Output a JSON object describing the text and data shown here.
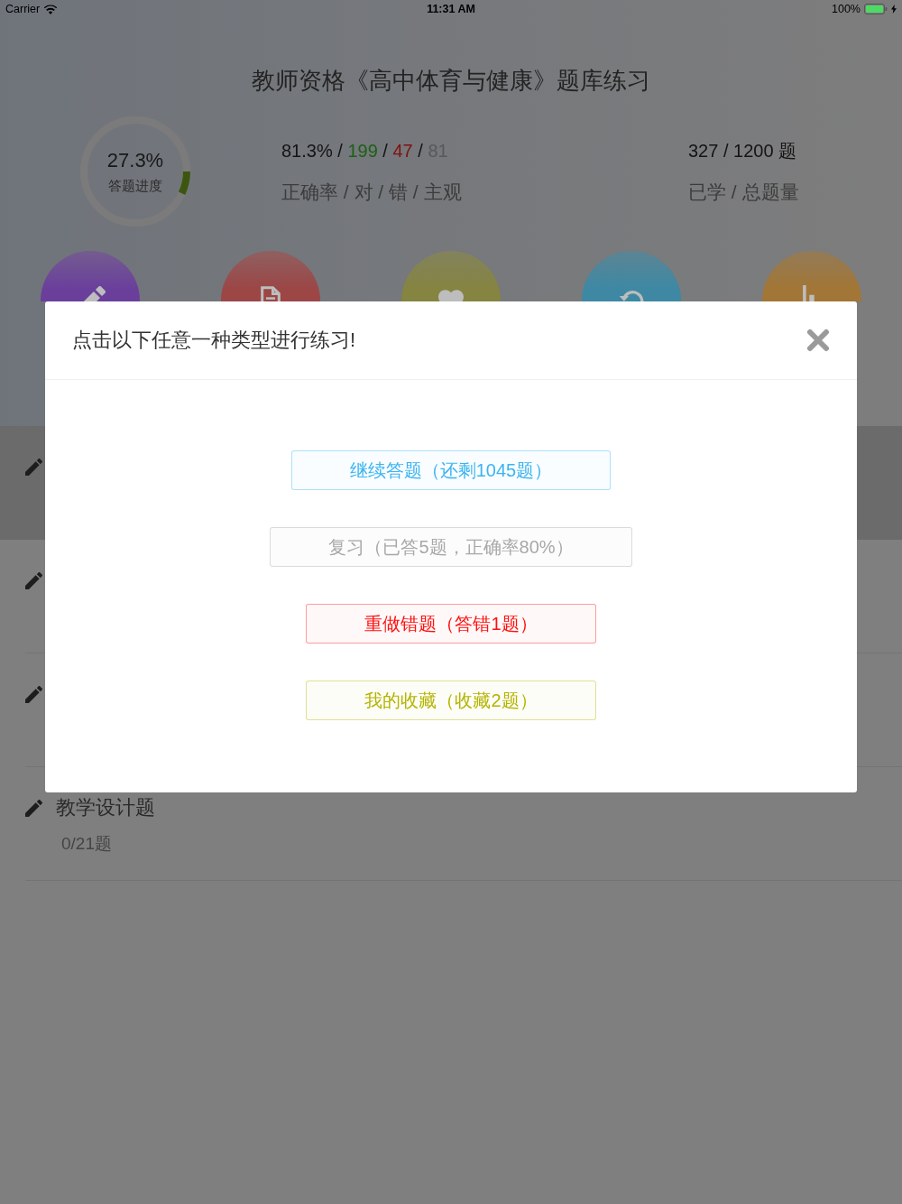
{
  "status_bar": {
    "carrier": "Carrier",
    "time": "11:31 AM",
    "battery": "100%"
  },
  "header": {
    "title": "教师资格《高中体育与健康》题库练习",
    "progress": {
      "value": "27.3%",
      "label": "答题进度",
      "level": 0.07
    },
    "accuracy": {
      "parts": [
        {
          "text": "81.3%",
          "kind": "rate"
        },
        {
          "text": "/",
          "kind": "separator"
        },
        {
          "text": "199",
          "kind": "correct"
        },
        {
          "text": "/",
          "kind": "separator"
        },
        {
          "text": "47",
          "kind": "wrong"
        },
        {
          "text": "/",
          "kind": "separator"
        },
        {
          "text": "81",
          "kind": "subjective"
        }
      ],
      "label": "正确率 / 对 / 错 / 主观"
    },
    "studied": {
      "value": "327 / 1200 题",
      "label": "已学 / 总题量"
    },
    "shortcuts": [
      {
        "kind": "pencil",
        "color": "#6a3f9c"
      },
      {
        "kind": "document",
        "color": "#9c4646"
      },
      {
        "kind": "heart",
        "color": "#858441"
      },
      {
        "kind": "refresh",
        "color": "#3e88a4"
      },
      {
        "kind": "chart",
        "color": "#a27636"
      }
    ]
  },
  "sections": [
    {
      "selected": true
    },
    {
      "selected": false
    },
    {
      "selected": false
    },
    {
      "title": "教学设计题",
      "progress": "0/21题",
      "selected": false
    }
  ],
  "dialog": {
    "title": "点击以下任意一种类型进行练习!",
    "options": [
      {
        "label": "继续答题（还剩1045题）",
        "color": "#3cb4f0"
      },
      {
        "label": "复习（已答5题，正确率80%）",
        "color": "#a8a8a8"
      },
      {
        "label": "重做错题（答错1题）",
        "color": "#ff1010"
      },
      {
        "label": "我的收藏（收藏2题）",
        "color": "#b4b400"
      }
    ]
  }
}
